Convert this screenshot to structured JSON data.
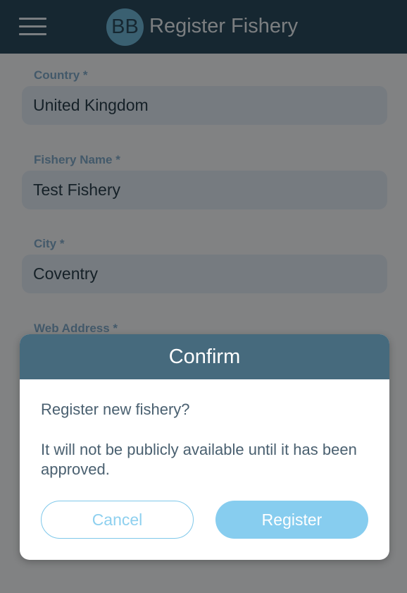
{
  "header": {
    "logo_text": "BB",
    "title": "Register Fishery"
  },
  "form": {
    "country": {
      "label": "Country *",
      "value": "United Kingdom"
    },
    "fishery_name": {
      "label": "Fishery Name *",
      "value": "Test Fishery"
    },
    "city": {
      "label": "City *",
      "value": "Coventry"
    },
    "web_address": {
      "label": "Web Address *"
    }
  },
  "dialog": {
    "title": "Confirm",
    "message": "Register new fishery?",
    "detail": "It will not be publicly available until it has been approved.",
    "cancel_label": "Cancel",
    "register_label": "Register"
  },
  "colors": {
    "header": "#2b4a5e",
    "dialog_header": "#466a7d",
    "accent": "#87cdef"
  }
}
